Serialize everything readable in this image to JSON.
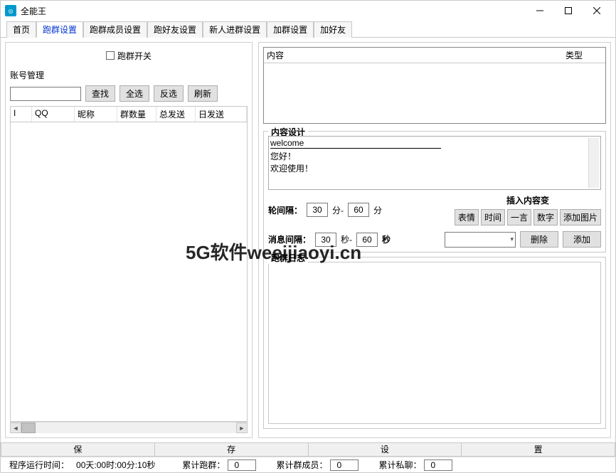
{
  "window": {
    "title": "全能王"
  },
  "tabs": [
    "首页",
    "跑群设置",
    "跑群成员设置",
    "跑好友设置",
    "新人进群设置",
    "加群设置",
    "加好友"
  ],
  "active_tab": 1,
  "left": {
    "switch_label": "跑群开关",
    "account_mgmt": "账号管理",
    "buttons": {
      "find": "查找",
      "select_all": "全选",
      "invert": "反选",
      "refresh": "刷新"
    },
    "columns": [
      "I",
      "QQ",
      "昵称",
      "群数量",
      "总发送",
      "日发送"
    ]
  },
  "right": {
    "content_cols": {
      "content": "内容",
      "type": "类型"
    },
    "content_settings_title": "内容设计",
    "content_settings_underline": "welcome",
    "content_settings_body": "您好！\n欢迎使用！",
    "round_interval_label": "轮间隔：",
    "round_min1": "30",
    "unit_min1": "分-",
    "round_min2": "60",
    "unit_min2": "分",
    "msg_interval_label": "消息间隔：",
    "msg_sec1": "30",
    "unit_sec1": "秒-",
    "msg_sec2": "60",
    "unit_sec2": "秒",
    "insert_title": "插入内容变",
    "insert_buttons": [
      "表情",
      "时间",
      "一言",
      "数字",
      "添加图片"
    ],
    "delete_btn": "删除",
    "add_btn": "添加",
    "log_title": "跑群日志"
  },
  "save_bar": [
    "保",
    "存",
    "设",
    "置"
  ],
  "status": {
    "runtime_label": "程序运行时间：",
    "runtime_value": "00天:00时:00分:10秒",
    "run_group_label": "累计跑群：",
    "run_group_value": "0",
    "group_member_label": "累计群成员：",
    "group_member_value": "0",
    "priv_chat_label": "累计私聊：",
    "priv_chat_value": "0"
  },
  "watermark": "5G软件weeijiaoyi.cn"
}
